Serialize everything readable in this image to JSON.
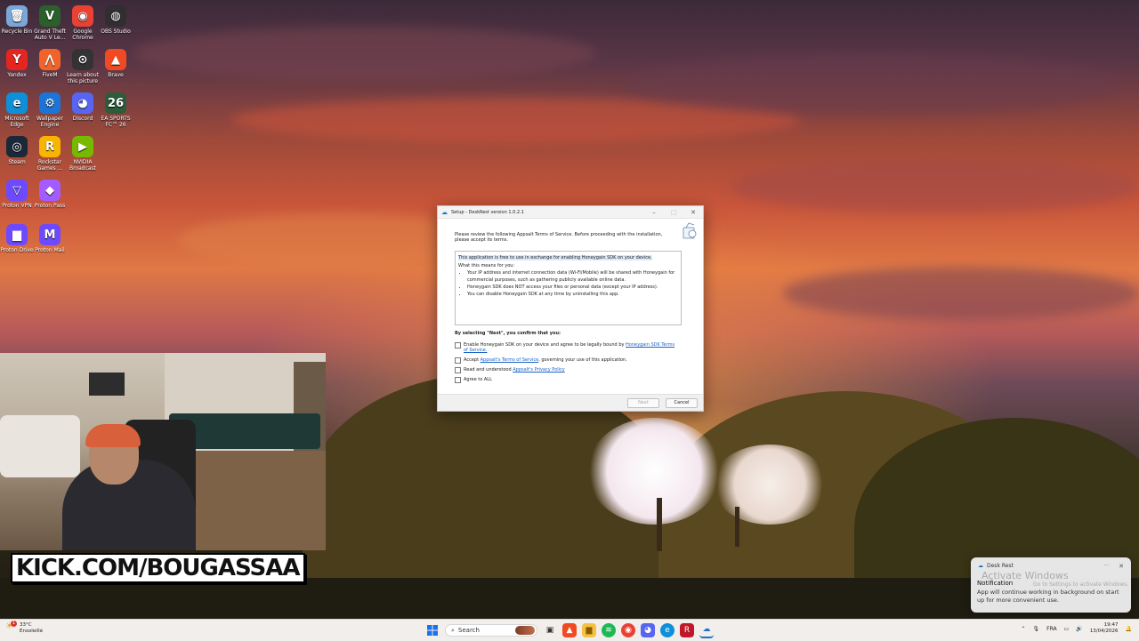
{
  "desktop": {
    "icons": [
      {
        "label": "Recycle Bin",
        "glyph": "🗑",
        "color": "#7aa7d8"
      },
      {
        "label": "Grand Theft Auto V Le...",
        "glyph": "V",
        "color": "#2b5f2b"
      },
      {
        "label": "Google Chrome",
        "glyph": "◉",
        "color": "#e94235"
      },
      {
        "label": "OBS Studio",
        "glyph": "◍",
        "color": "#302e31"
      },
      {
        "label": "Yandex",
        "glyph": "Y",
        "color": "#e52620"
      },
      {
        "label": "FiveM",
        "glyph": "⋀",
        "color": "#f0642a"
      },
      {
        "label": "Learn about this picture",
        "glyph": "⊙",
        "color": "#333333"
      },
      {
        "label": "Brave",
        "glyph": "▲",
        "color": "#f04a23"
      },
      {
        "label": "Microsoft Edge",
        "glyph": "e",
        "color": "#0f8fd8"
      },
      {
        "label": "Wallpaper Engine",
        "glyph": "⚙",
        "color": "#1b74d8"
      },
      {
        "label": "Discord",
        "glyph": "◕",
        "color": "#5865f2"
      },
      {
        "label": "EA SPORTS FC™ 26",
        "glyph": "26",
        "color": "#2c5c3a"
      },
      {
        "label": "Steam",
        "glyph": "◎",
        "color": "#1b2838"
      },
      {
        "label": "Rockstar Games ...",
        "glyph": "R",
        "color": "#f7b500"
      },
      {
        "label": "NVIDIA Broadcast",
        "glyph": "▶",
        "color": "#76b900"
      },
      {
        "label": "Proton VPN",
        "glyph": "▽",
        "color": "#6d4aff"
      },
      {
        "label": "Proton Pass",
        "glyph": "◆",
        "color": "#a35cff"
      },
      {
        "label": "Proton Drive",
        "glyph": "▆",
        "color": "#6d4aff"
      },
      {
        "label": "Proton Mail",
        "glyph": "M",
        "color": "#6d4aff"
      }
    ]
  },
  "stream": {
    "brand": "KICK.COM/BOUGASSAA"
  },
  "dialog": {
    "title": "Setup - DeskRest version 1.0.2.1",
    "intro": "Please review the following Appsalt Terms of Service. Before proceeding with the installation, please accept its terms.",
    "tos_lead": "This application is free to use in exchange for enabling Honeygain SDK on your device.",
    "tos_means": "What this means for you:",
    "tos_bullets": [
      "Your IP address and internet connection data (Wi-Fi/Mobile) will be shared with Honeygain for commercial purposes, such as gathering publicly available online data.",
      "Honeygain SDK does NOT access your files or personal data (except your IP address).",
      "You can disable Honeygain SDK at any time by uninstalling this app."
    ],
    "confirm_heading": "By selecting \"Next\", you confirm that you:",
    "checks": {
      "c1_text": "Enable Honeygain SDK on your device and agree to be legally bound by ",
      "c1_link": "Honeygain SDK Terms of Service.",
      "c2_pre": "Accept ",
      "c2_link": "Appsalt's Terms of Service",
      "c2_post": ", governing your use of this application.",
      "c3_text": "Read and understood ",
      "c3_link": "Appsalt's Privacy Policy",
      "c4_text": "Agree to ALL"
    },
    "next_label": "Next",
    "cancel_label": "Cancel"
  },
  "notification": {
    "app": "Desk Rest",
    "watermark": "Activate Windows",
    "watermark_sub": "Go to Settings to activate Windows.",
    "heading": "Notification",
    "body": "App will continue working in background on start up for more convenient use."
  },
  "taskbar": {
    "weather_temp": "33°C",
    "weather_desc": "Ensoleillé",
    "weather_badge": "1",
    "search_placeholder": "Search",
    "lang": "FRA",
    "time": "19:47",
    "date": "13/04/2026"
  }
}
